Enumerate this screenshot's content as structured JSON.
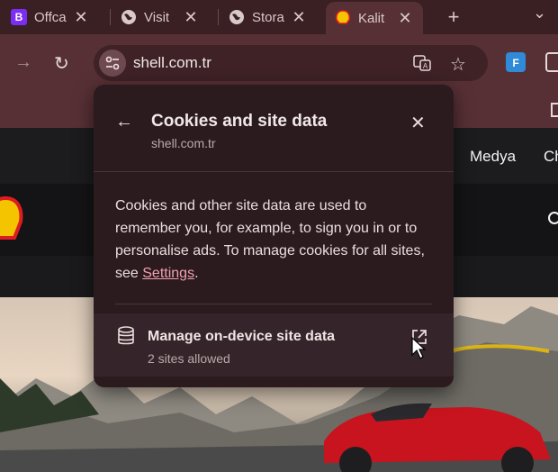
{
  "tabs": [
    {
      "title": "Offca",
      "favicon_letter": "B",
      "favicon_color": "#7b2cf5"
    },
    {
      "title": "Visit",
      "favicon": "globe-icon"
    },
    {
      "title": "Stora",
      "favicon": "globe-icon"
    },
    {
      "title": "Kalit",
      "favicon": "shell-logo-icon",
      "active": true
    }
  ],
  "toolbar": {
    "url": "shell.com.tr"
  },
  "page": {
    "nav_items": [
      "Medya",
      "Ch"
    ]
  },
  "popup": {
    "title": "Cookies and site data",
    "subtitle": "shell.com.tr",
    "description_before": "Cookies and other site data are used to remember you, for example, to sign you in or to personalise ads. To manage cookies for all sites, see ",
    "settings_link": "Settings",
    "description_after": ".",
    "manage_row": {
      "label": "Manage on-device site data",
      "sublabel": "2 sites allowed"
    }
  },
  "colors": {
    "accent_link": "#f0a0b0",
    "popup_bg": "#2b1b1e",
    "toolbar_bg": "#573035"
  }
}
